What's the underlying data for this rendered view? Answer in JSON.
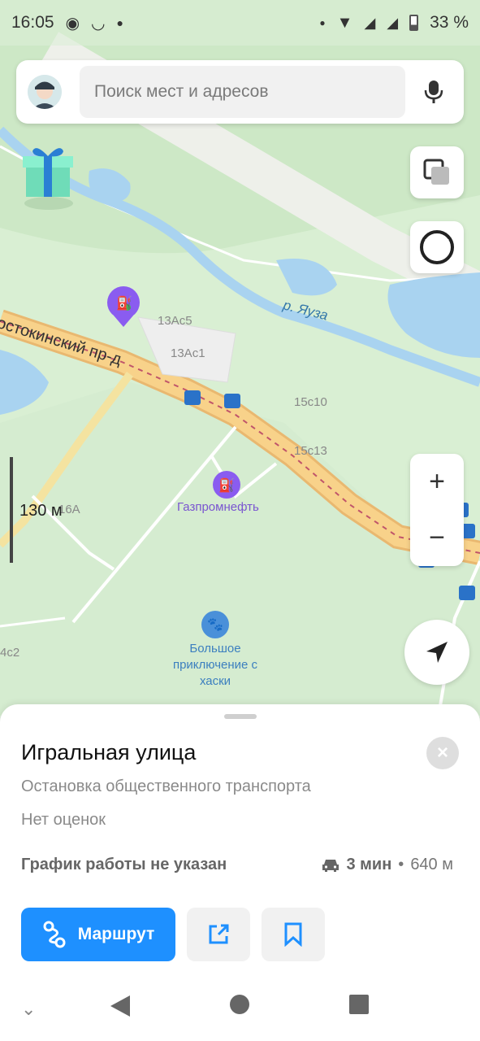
{
  "status_bar": {
    "time": "16:05",
    "battery": "33 %"
  },
  "search": {
    "placeholder": "Поиск мест и адресов"
  },
  "map": {
    "street_name": "остокинский пр-д",
    "river_name": "р. Яуза",
    "buildings": [
      "13Ас5",
      "13Ас1",
      "15с10",
      "15с13",
      "16А",
      "4с2"
    ],
    "poi_fuel_name": "Газпромнефть",
    "poi_fun_name": "Большое приключение с хаски",
    "scale_label": "130 м",
    "zoom_in": "+",
    "zoom_out": "−"
  },
  "place": {
    "title": "Игральная улица",
    "type": "Остановка общественного транспорта",
    "rating": "Нет оценок",
    "hours": "График работы не указан",
    "eta_time": "3 мин",
    "eta_sep": "•",
    "eta_distance": "640 м",
    "close_glyph": "×"
  },
  "actions": {
    "route_label": "Маршрут"
  },
  "colors": {
    "accent": "#1e90ff",
    "road": "#f8d28a",
    "water": "#a9d3f0",
    "park": "#d9efd3",
    "poi_purple": "#8a5cf0",
    "poi_blue": "#4a90d9"
  },
  "icons": {
    "gift": "gift-icon",
    "layers": "layers-icon",
    "alice": "alice-icon",
    "mic": "microphone-icon",
    "locate": "navigation-arrow-icon",
    "car": "car-icon",
    "route": "route-icon",
    "share": "share-icon",
    "bookmark": "bookmark-icon"
  }
}
